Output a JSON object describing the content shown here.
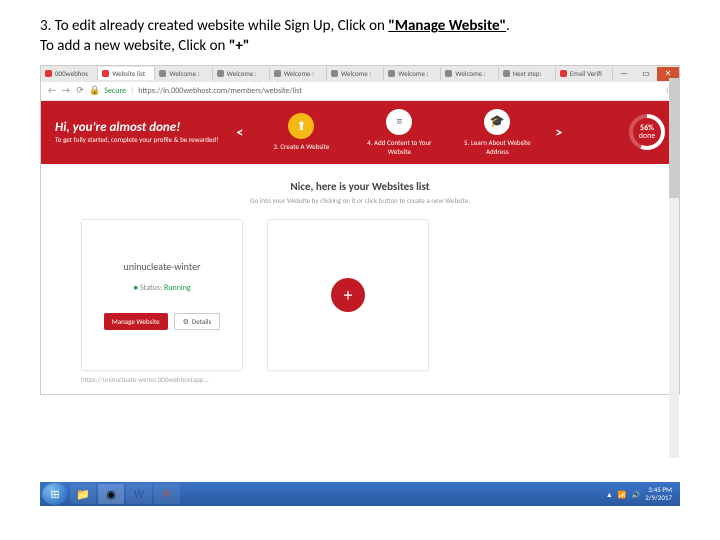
{
  "instruction": {
    "line1a": "3.  To edit already created website while Sign Up, Click on ",
    "line1b": "\"Manage Website\"",
    "line1c": ".",
    "line2a": "To add a new website, Click on ",
    "line2b": "\"+\""
  },
  "browser": {
    "tabs": [
      "000webhos",
      "Website list",
      "Welcome :",
      "Welcome :",
      "Welcome :",
      "Welcome :",
      "Welcome :",
      "Welcome :",
      "Next step:",
      "Email Verifi"
    ],
    "active_tab_index": 1,
    "secure_label": "Secure",
    "url": "https://in.000webhost.com/members/website/list",
    "window_buttons": {
      "min": "—",
      "max": "▭",
      "close": "✕"
    }
  },
  "banner": {
    "title": "Hi, you're almost done!",
    "subtitle": "To get fully started, complete your profile & be rewarded!",
    "steps": [
      {
        "num": "3.",
        "label": "Create A Website"
      },
      {
        "num": "4.",
        "label": "Add Content to Your Website"
      },
      {
        "num": "5.",
        "label": "Learn About Website Address"
      }
    ],
    "progress_pct": "56%",
    "progress_label": "done"
  },
  "main": {
    "heading": "Nice, here is your Websites list",
    "subheading": "Go into your Website by clicking on it or click button to create a new Website.",
    "site": {
      "name": "uninucleate-winter",
      "status_label": "Status:",
      "status_value": "Running",
      "manage_btn": "Manage Website",
      "details_btn": "Details",
      "url": "https://uninucleate-winter.000webhostapp..."
    },
    "add_symbol": "+"
  },
  "taskbar": {
    "icons": [
      "folder",
      "chrome",
      "word",
      "powerpoint"
    ],
    "time": "3:45 PM",
    "date": "2/9/2017"
  }
}
